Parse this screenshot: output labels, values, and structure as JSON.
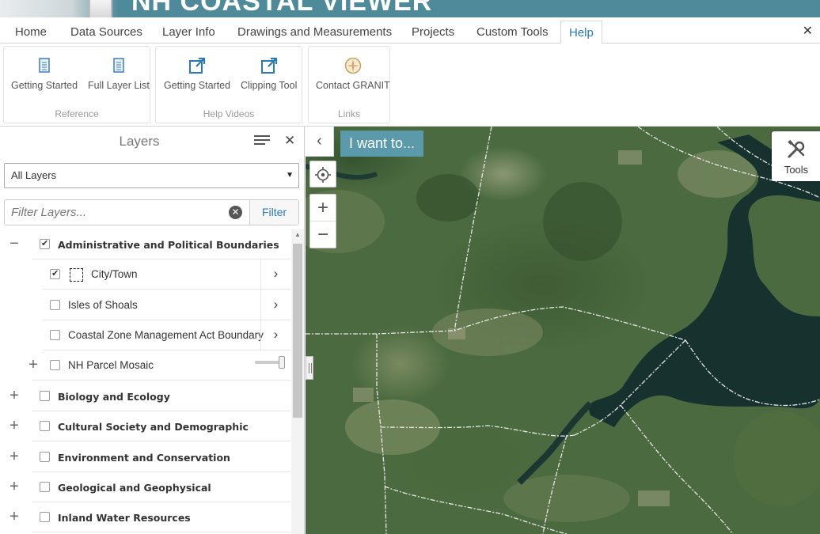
{
  "banner": {
    "title": "NH COASTAL VIEWER"
  },
  "tabs": [
    {
      "label": "Home",
      "active": false
    },
    {
      "label": "Data Sources",
      "active": false
    },
    {
      "label": "Layer Info",
      "active": false
    },
    {
      "label": "Drawings and Measurements",
      "active": false
    },
    {
      "label": "Projects",
      "active": false
    },
    {
      "label": "Custom Tools",
      "active": false
    },
    {
      "label": "Help",
      "active": true
    }
  ],
  "ribbon": {
    "close_icon": "close-icon",
    "groups": [
      {
        "label": "Reference",
        "buttons": [
          {
            "label": "Getting Started",
            "icon": "document-icon"
          },
          {
            "label": "Full Layer List",
            "icon": "document-icon"
          }
        ]
      },
      {
        "label": "Help Videos",
        "buttons": [
          {
            "label": "Getting Started",
            "icon": "external-link-icon"
          },
          {
            "label": "Clipping Tool",
            "icon": "external-link-icon"
          }
        ]
      },
      {
        "label": "Links",
        "buttons": [
          {
            "label": "Contact GRANIT",
            "icon": "compass-icon"
          }
        ]
      }
    ]
  },
  "layers_panel": {
    "title": "Layers",
    "layer_select": {
      "value": "All Layers"
    },
    "filter": {
      "placeholder": "Filter Layers...",
      "value": "",
      "button_label": "Filter"
    },
    "tree": [
      {
        "label": "Administrative and Political Boundaries",
        "checked": true,
        "expanded": true,
        "level": 0
      },
      {
        "label": "City/Town",
        "checked": true,
        "level": 1,
        "has_legend": true,
        "has_details": true
      },
      {
        "label": "Isles of Shoals",
        "checked": false,
        "level": 1,
        "has_details": true
      },
      {
        "label": "Coastal Zone Management Act Boundary",
        "checked": false,
        "level": 1,
        "has_details": true
      },
      {
        "label": "NH Parcel Mosaic",
        "checked": false,
        "level": 1,
        "expandable": true,
        "opacity": 1.0
      },
      {
        "label": "Biology and Ecology",
        "checked": false,
        "expanded": false,
        "level": 0
      },
      {
        "label": "Cultural Society and Demographic",
        "checked": false,
        "expanded": false,
        "level": 0
      },
      {
        "label": "Environment and Conservation",
        "checked": false,
        "expanded": false,
        "level": 0
      },
      {
        "label": "Geological and Geophysical",
        "checked": false,
        "expanded": false,
        "level": 0
      },
      {
        "label": "Inland Water Resources",
        "checked": false,
        "expanded": false,
        "level": 0
      }
    ]
  },
  "map": {
    "i_want_to_label": "I want to...",
    "tools_label": "Tools",
    "water_color": "#16312e",
    "boundary_color": "#e8e8e8"
  },
  "colors": {
    "accent": "#2a7ab8",
    "banner": "#4e8a9a",
    "i_want_bg": "#5a9aaa"
  }
}
